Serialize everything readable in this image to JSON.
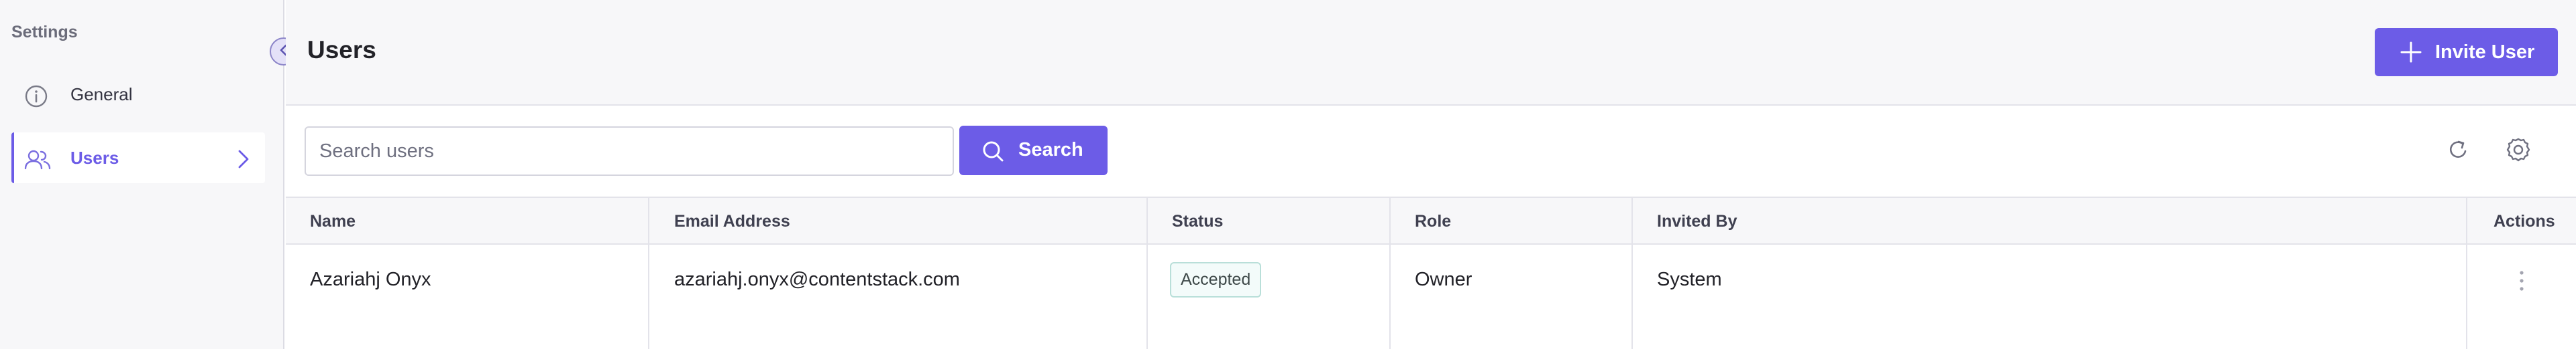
{
  "sidebar": {
    "title": "Settings",
    "items": [
      {
        "label": "General",
        "icon": "info-icon",
        "active": false
      },
      {
        "label": "Users",
        "icon": "users-icon",
        "active": true
      }
    ]
  },
  "header": {
    "title": "Users",
    "invite_label": "Invite User"
  },
  "toolbar": {
    "search_placeholder": "Search users",
    "search_value": "",
    "search_label": "Search"
  },
  "table": {
    "columns": [
      "Name",
      "Email Address",
      "Status",
      "Role",
      "Invited By",
      "Actions"
    ],
    "rows": [
      {
        "name": "Azariahj Onyx",
        "email": "azariahj.onyx@contentstack.com",
        "status": "Accepted",
        "role": "Owner",
        "invited_by": "System"
      }
    ]
  },
  "colors": {
    "accent": "#6c5ce7",
    "sidebar_bg": "#f7f7f9",
    "status_border": "#b9dfd9"
  }
}
